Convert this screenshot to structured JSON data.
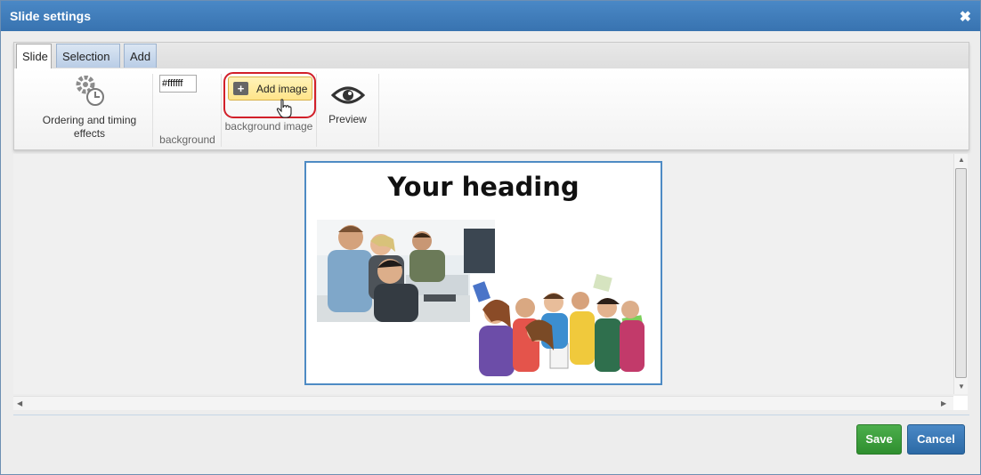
{
  "dialog": {
    "title": "Slide settings",
    "close_glyph": "✖"
  },
  "tabs": [
    {
      "label": "Slide",
      "active": true
    },
    {
      "label": "Selection",
      "active": false
    },
    {
      "label": "Add",
      "active": false
    }
  ],
  "ribbon": {
    "ordering": {
      "label": "Ordering and timing effects",
      "icon": "gear-clock-icon"
    },
    "background": {
      "value": "#ffffff",
      "label": "background"
    },
    "background_image": {
      "button_label": "Add image",
      "plus": "+",
      "label": "background image"
    },
    "preview": {
      "label": "Preview",
      "icon": "eye-icon"
    }
  },
  "slide": {
    "heading": "Your heading"
  },
  "footer": {
    "save_label": "Save",
    "cancel_label": "Cancel"
  },
  "colors": {
    "title_bar": "#3a78b5",
    "save": "#3c9e3c",
    "cancel": "#3575b5",
    "highlight_ring": "#d2202a",
    "slide_border": "#4e8bc4"
  }
}
